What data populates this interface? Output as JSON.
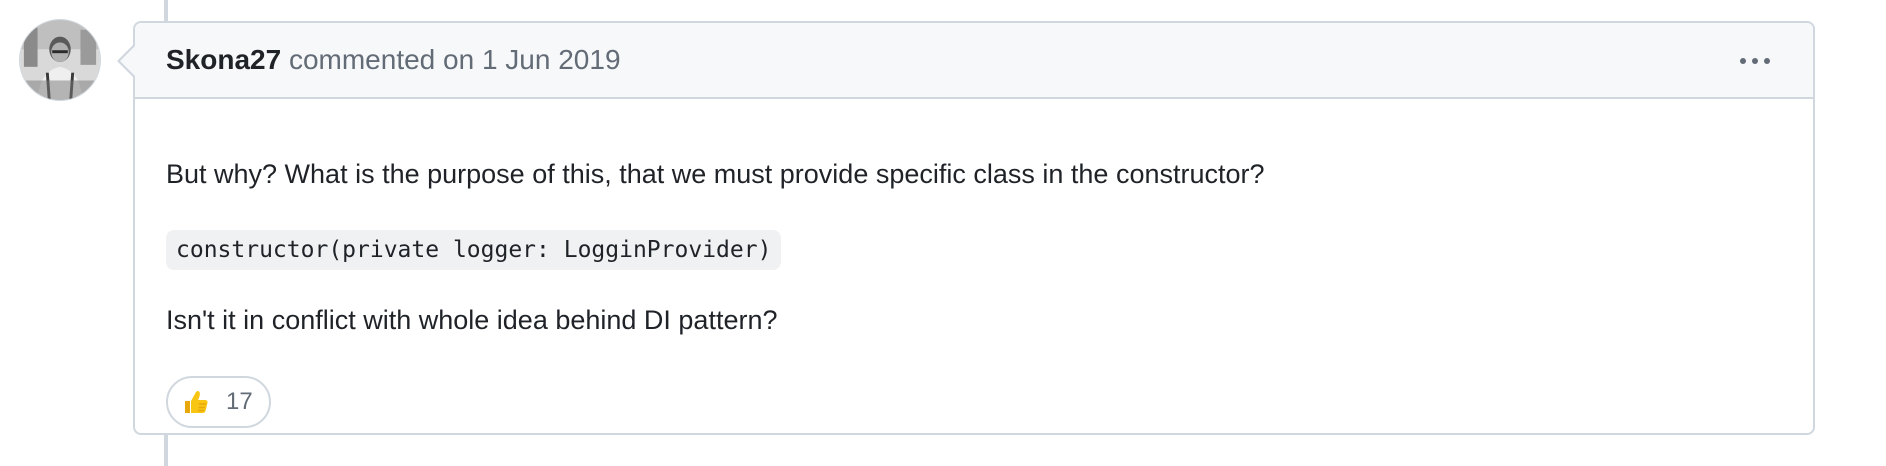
{
  "comment": {
    "author": "Skona27",
    "action_text": "commented on",
    "date": "1 Jun 2019",
    "body": {
      "paragraph1": "But why? What is the purpose of this, that we must provide specific class in the constructor?",
      "code": "constructor(private logger: LogginProvider)",
      "paragraph2": "Isn't it in conflict with whole idea behind DI pattern?"
    },
    "reactions": [
      {
        "emoji": "thumbs-up",
        "count": "17"
      }
    ],
    "menu_icon": "kebab-horizontal-icon"
  },
  "colors": {
    "border": "#d0d7de",
    "header_bg": "#f6f8fa",
    "muted_text": "#636c76",
    "code_bg": "#eff1f3"
  }
}
